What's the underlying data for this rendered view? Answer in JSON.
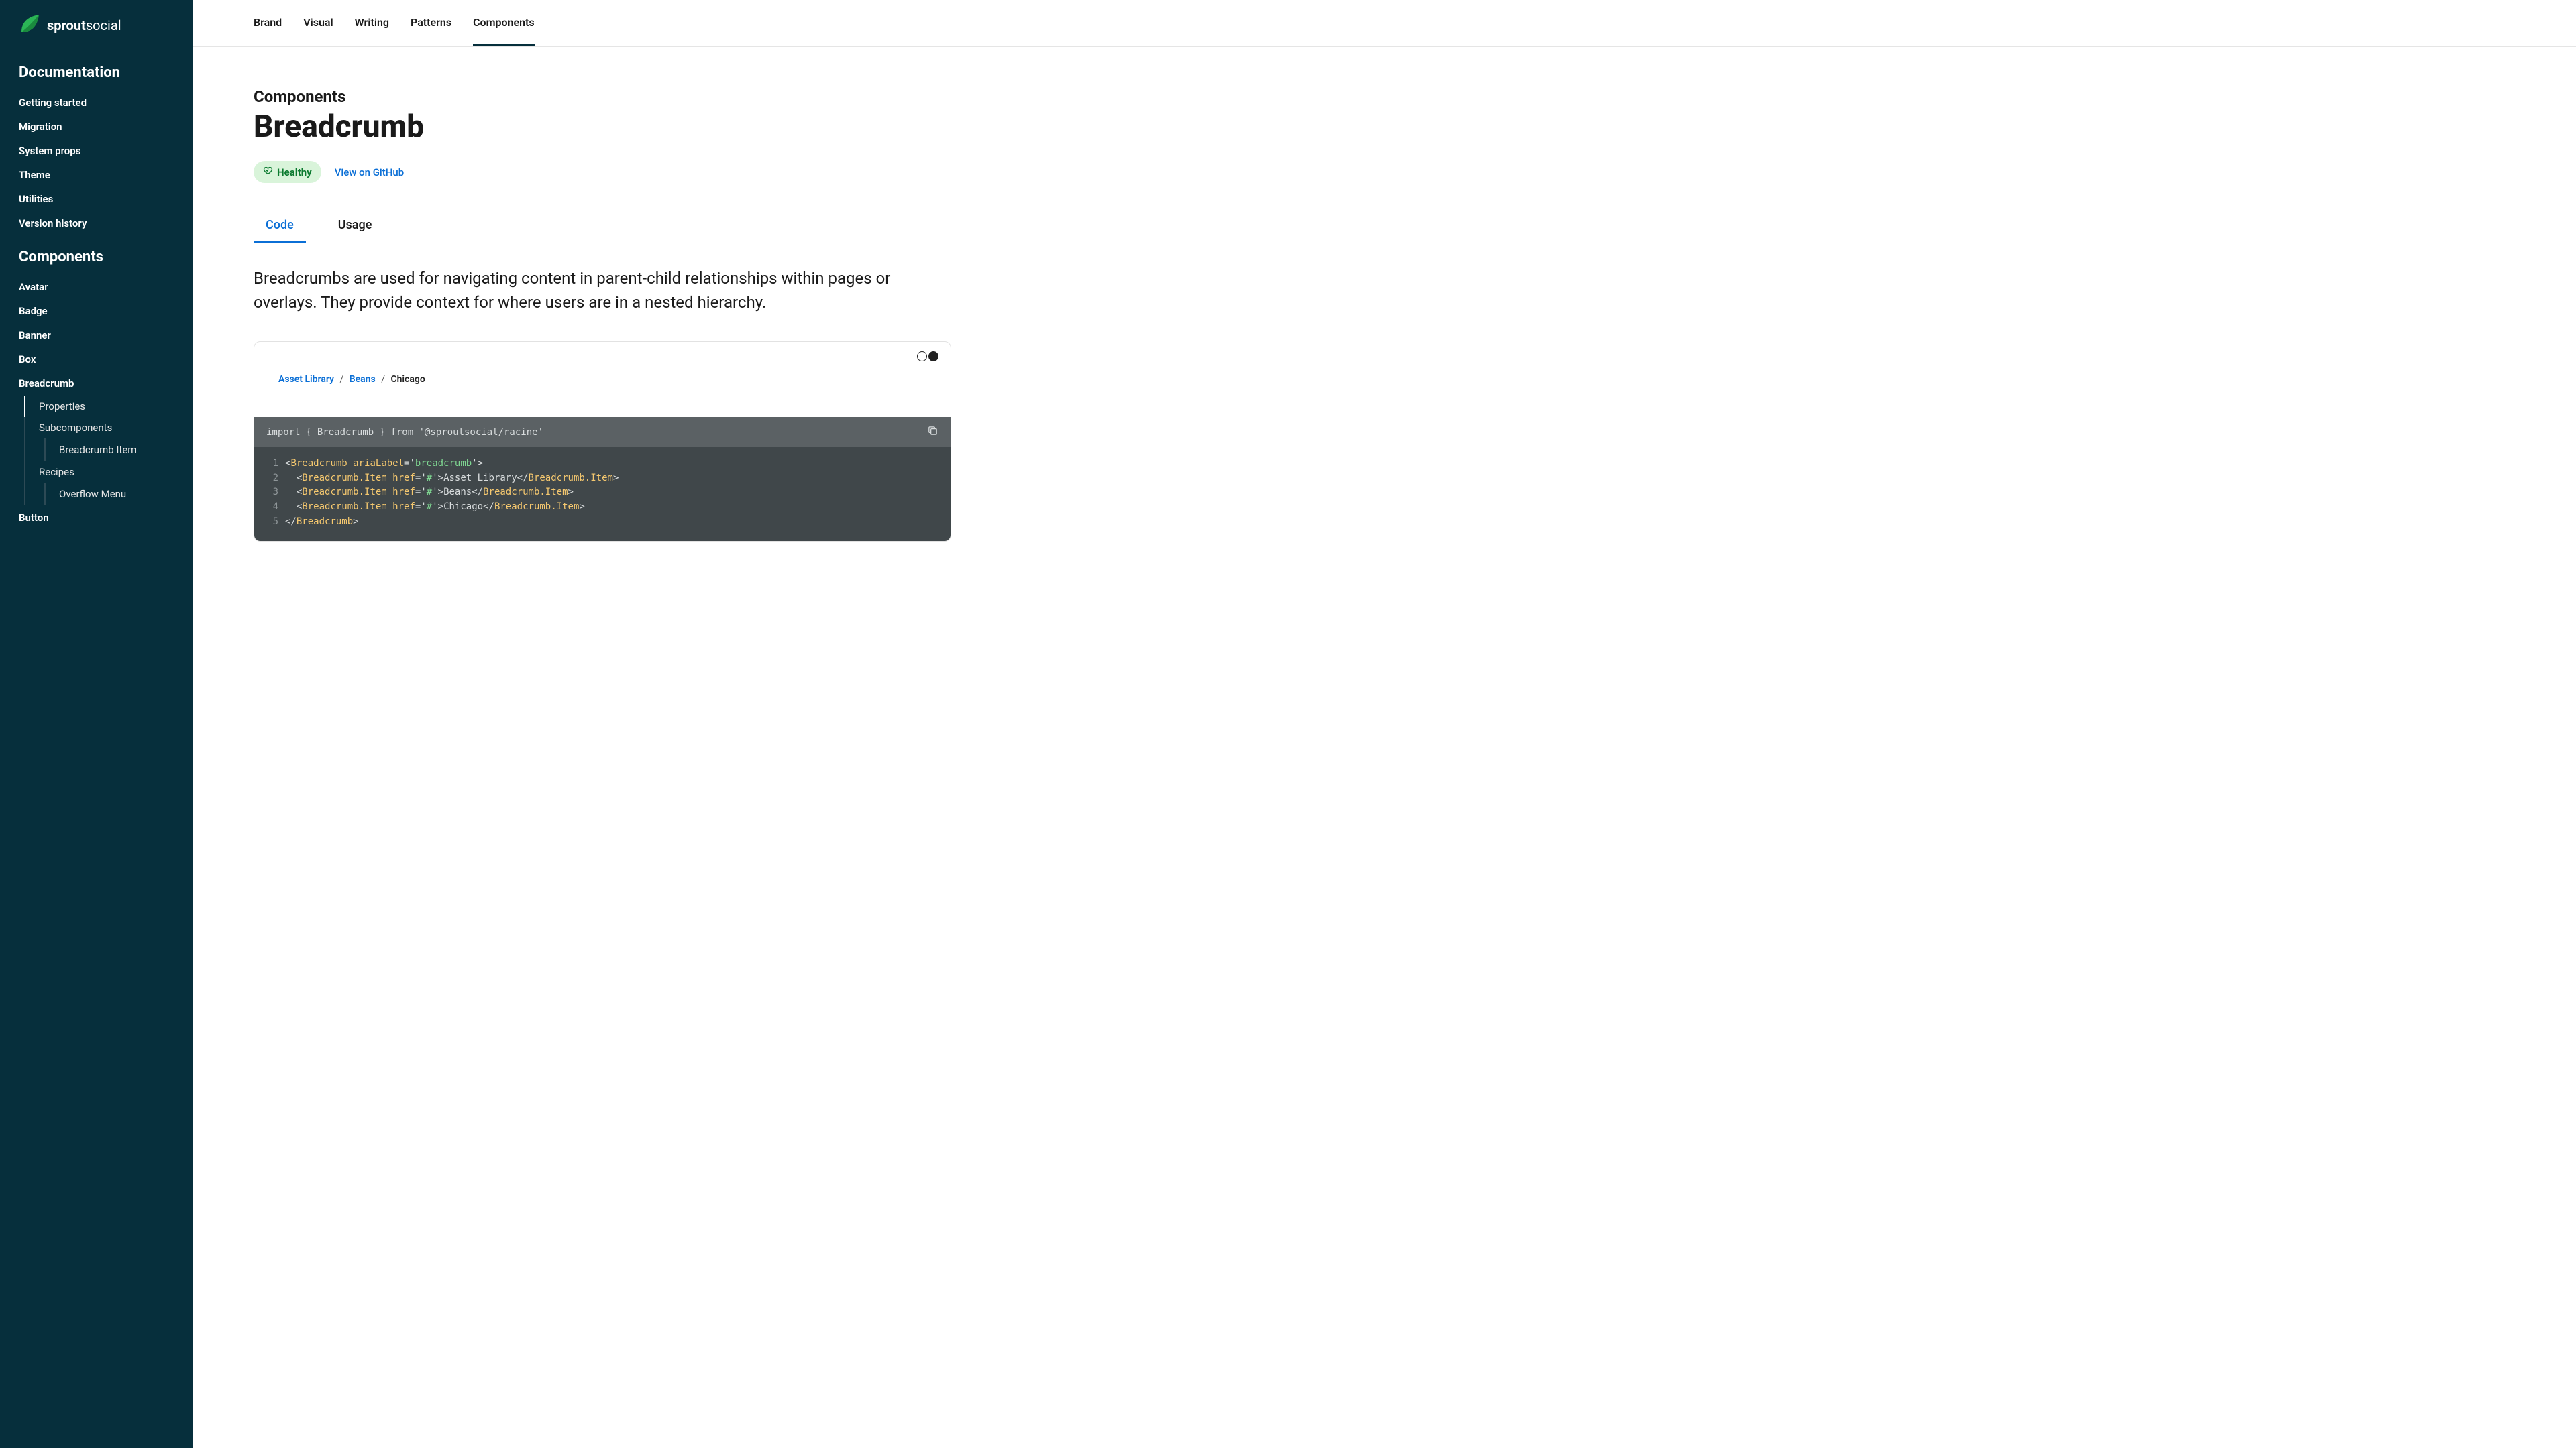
{
  "logo": {
    "brand_bold": "sprout",
    "brand_light": "social"
  },
  "sidebar": {
    "group1_title": "Documentation",
    "group1_items": [
      "Getting started",
      "Migration",
      "System props",
      "Theme",
      "Utilities",
      "Version history"
    ],
    "group2_title": "Components",
    "group2_items": [
      "Avatar",
      "Badge",
      "Banner",
      "Box"
    ],
    "current": "Breadcrumb",
    "current_subs": [
      "Properties",
      "Subcomponents"
    ],
    "current_sub2": "Breadcrumb Item",
    "current_subs2": [
      "Recipes"
    ],
    "current_sub2b": "Overflow Menu",
    "after_current": [
      "Button"
    ]
  },
  "topnav": [
    "Brand",
    "Visual",
    "Writing",
    "Patterns",
    "Components"
  ],
  "page": {
    "eyebrow": "Components",
    "title": "Breadcrumb",
    "badge_label": "Healthy",
    "gh_label": "View on GitHub",
    "tabs": [
      "Code",
      "Usage"
    ],
    "lead": "Breadcrumbs are used for navigating content in parent-child relationships within pages or overlays. They provide context for where users are in a nested hierarchy."
  },
  "example": {
    "crumbs": [
      "Asset Library",
      "Beans",
      "Chicago"
    ],
    "sep": "/",
    "import_line": "import { Breadcrumb } from '@sproutsocial/racine'"
  },
  "code": {
    "l1": {
      "open": "<",
      "tag": "Breadcrumb",
      "attr": "ariaLabel",
      "eq": "=",
      "q": "'",
      "val": "breadcrumb",
      "close": ">"
    },
    "item": {
      "open": "<",
      "tag": "Breadcrumb.Item",
      "attr": "href",
      "eq": "=",
      "q": "'",
      "val": "#",
      "gt": ">",
      "c_open": "</",
      "c_close": ">"
    },
    "texts": [
      "Asset Library",
      "Beans",
      "Chicago"
    ],
    "l5": {
      "open": "</",
      "tag": "Breadcrumb",
      "close": ">"
    }
  }
}
